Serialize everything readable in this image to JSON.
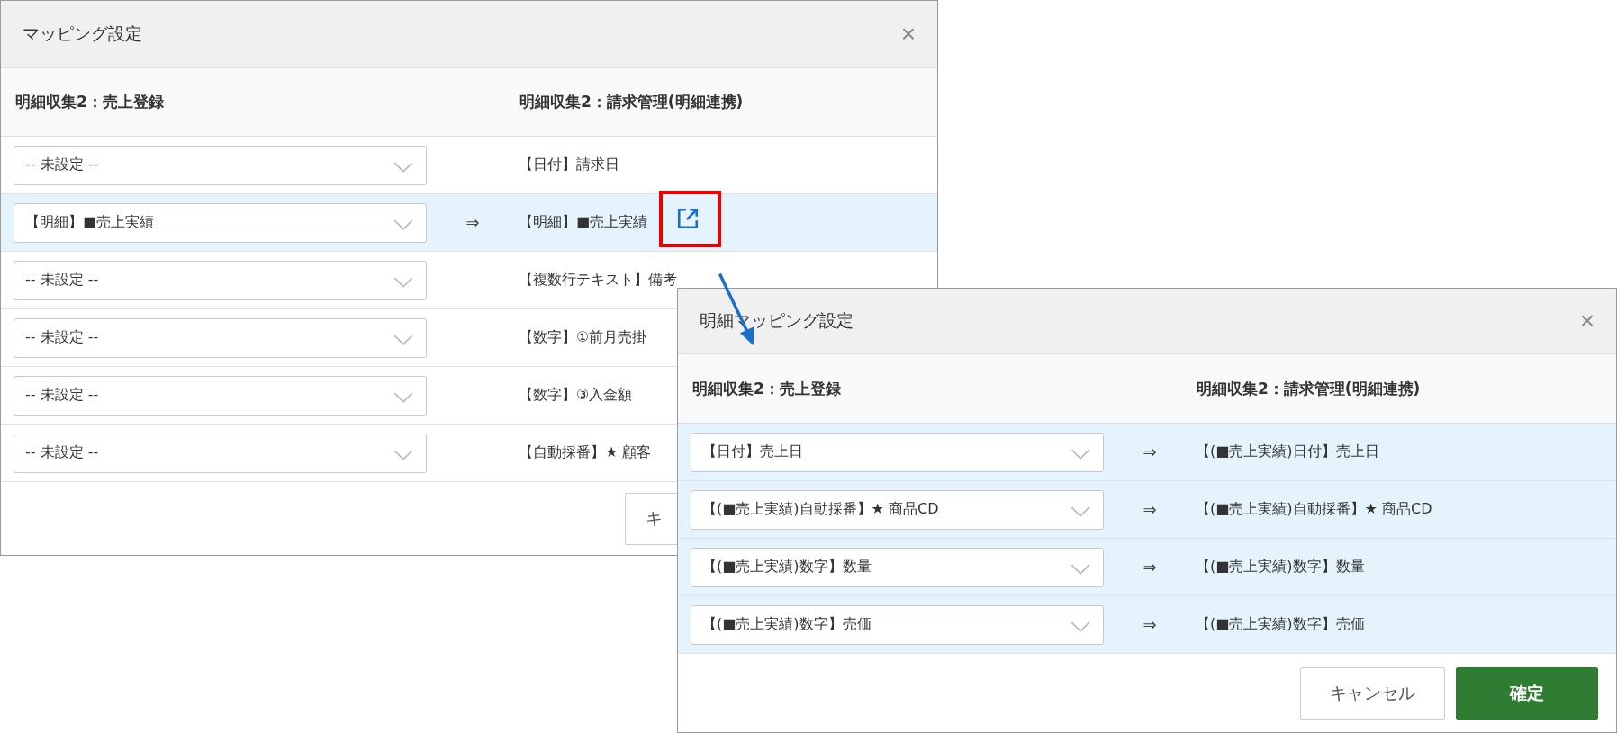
{
  "dialogs": [
    {
      "title": "マッピング設定",
      "close": "×",
      "columns": [
        "明細収集2：売上登録",
        "明細収集2：請求管理(明細連携)"
      ],
      "rows": [
        {
          "field": "-- 未設定 --",
          "target": "【日付】請求日",
          "selected": false
        },
        {
          "field": "【明細】■売上実績",
          "arrow": "⇒",
          "target": "【明細】■売上実績",
          "selected": true,
          "link": true
        },
        {
          "field": "-- 未設定 --",
          "target": "【複数行テキスト】備考",
          "selected": false
        },
        {
          "field": "-- 未設定 --",
          "target": "【数字】①前月売掛",
          "selected": false
        },
        {
          "field": "-- 未設定 --",
          "target": "【数字】③入金額",
          "selected": false
        },
        {
          "field": "-- 未設定 --",
          "target": "【自動採番】★ 顧客",
          "selected": false
        }
      ],
      "buttons": [
        {
          "label": "キ",
          "kind": "secondary"
        }
      ]
    },
    {
      "title": "明細マッピング設定",
      "close": "×",
      "columns": [
        "明細収集2：売上登録",
        "明細収集2：請求管理(明細連携)"
      ],
      "rows": [
        {
          "field": "【日付】売上日",
          "arrow": "⇒",
          "target": "【(■売上実績)日付】売上日",
          "selected": true
        },
        {
          "field": "【(■売上実績)自動採番】★ 商品CD",
          "arrow": "⇒",
          "target": "【(■売上実績)自動採番】★ 商品CD",
          "selected": true
        },
        {
          "field": "【(■売上実績)数字】数量",
          "arrow": "⇒",
          "target": "【(■売上実績)数字】数量",
          "selected": true
        },
        {
          "field": "【(■売上実績)数字】売価",
          "arrow": "⇒",
          "target": "【(■売上実績)数字】売価",
          "selected": true
        }
      ],
      "buttons": [
        {
          "label": "キャンセル",
          "kind": "secondary"
        },
        {
          "label": "確定",
          "kind": "primary"
        }
      ]
    }
  ]
}
